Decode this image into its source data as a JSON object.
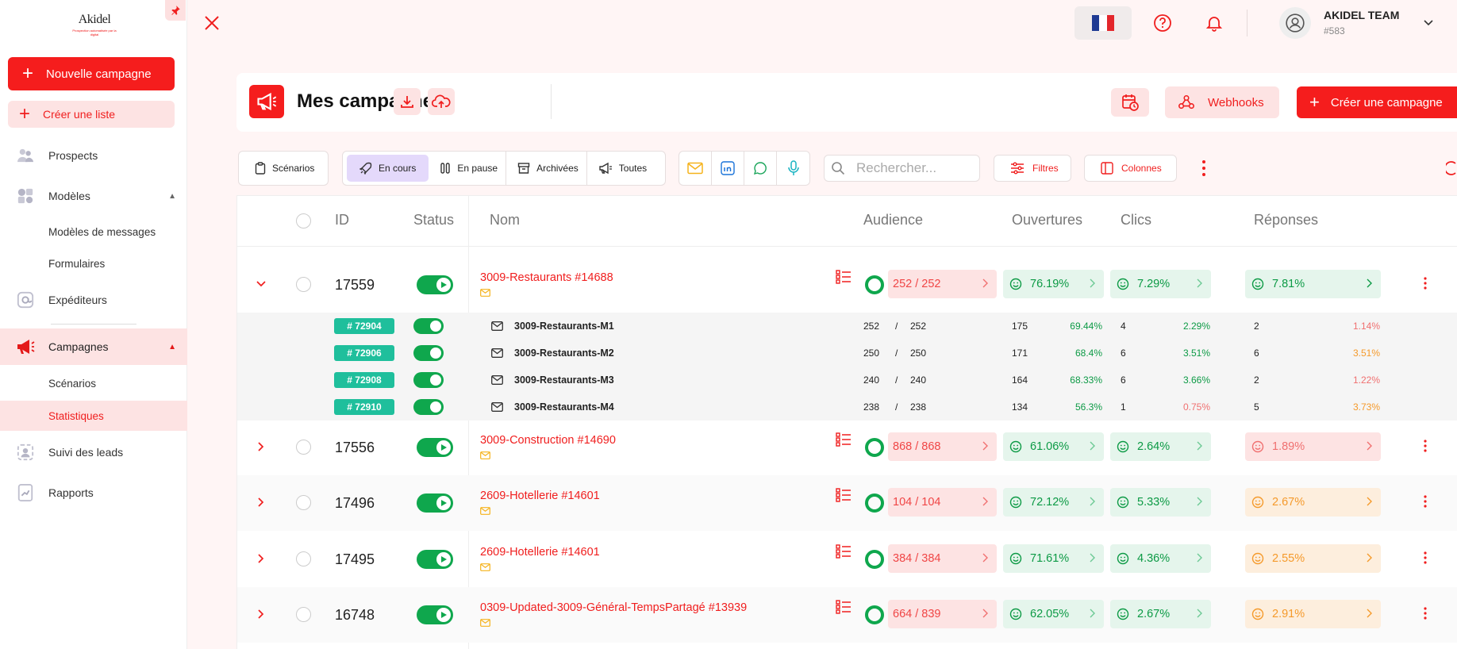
{
  "sidebar": {
    "logo_text": "Akidel",
    "logo_tag": "Prospection automatisée par la digital",
    "new_campaign": "Nouvelle campagne",
    "create_list": "Créer une liste",
    "items": {
      "prospects": "Prospects",
      "modeles": "Modèles",
      "modeles_messages": "Modèles de messages",
      "formulaires": "Formulaires",
      "expediteurs": "Expéditeurs",
      "campagnes": "Campagnes",
      "scenarios": "Scénarios",
      "statistiques": "Statistiques",
      "suivi": "Suivi des leads",
      "rapports": "Rapports"
    }
  },
  "topbar": {
    "user_name": "AKIDEL TEAM",
    "user_id": "#583"
  },
  "header": {
    "title": "Mes campagnes",
    "webhooks": "Webhooks",
    "create": "Créer une campagne"
  },
  "toolbar": {
    "scenarios": "Scénarios",
    "en_cours": "En cours",
    "en_pause": "En pause",
    "archivees": "Archivées",
    "toutes": "Toutes",
    "search_placeholder": "Rechercher...",
    "filtres": "Filtres",
    "colonnes": "Colonnes"
  },
  "table": {
    "headers": {
      "id": "ID",
      "status": "Status",
      "nom": "Nom",
      "audience": "Audience",
      "ouvertures": "Ouvertures",
      "clics": "Clics",
      "reponses": "Réponses"
    },
    "rows": [
      {
        "id": "17559",
        "name": "3009-Restaurants #14688",
        "audience": "252 / 252",
        "ouvertures": "76.19%",
        "clics": "7.29%",
        "reponses": "7.81%",
        "rep_tone": "g",
        "expanded": true
      },
      {
        "id": "17556",
        "name": "3009-Construction #14690",
        "audience": "868 / 868",
        "ouvertures": "61.06%",
        "clics": "2.64%",
        "reponses": "1.89%",
        "rep_tone": "r",
        "expanded": false
      },
      {
        "id": "17496",
        "name": "2609-Hotellerie #14601",
        "audience": "104 / 104",
        "ouvertures": "72.12%",
        "clics": "5.33%",
        "reponses": "2.67%",
        "rep_tone": "o",
        "expanded": false
      },
      {
        "id": "17495",
        "name": "2609-Hotellerie #14601",
        "audience": "384 / 384",
        "ouvertures": "71.61%",
        "clics": "4.36%",
        "reponses": "2.55%",
        "rep_tone": "o",
        "expanded": false
      },
      {
        "id": "16748",
        "name": "0309-Updated-3009-Général-TempsPartagé #13939",
        "audience": "664 / 839",
        "ouvertures": "62.05%",
        "clics": "2.67%",
        "reponses": "2.91%",
        "rep_tone": "o",
        "expanded": false
      }
    ],
    "subrows": [
      {
        "badge": "# 72904",
        "name": "3009-Restaurants-M1",
        "aud_a": "252",
        "aud_b": "252",
        "open_n": "175",
        "open_p": "69.44%",
        "click_n": "4",
        "click_p": "2.29%",
        "click_tone": "g",
        "rep_n": "2",
        "rep_p": "1.14%",
        "rep_tone": "r"
      },
      {
        "badge": "# 72906",
        "name": "3009-Restaurants-M2",
        "aud_a": "250",
        "aud_b": "250",
        "open_n": "171",
        "open_p": "68.4%",
        "click_n": "6",
        "click_p": "3.51%",
        "click_tone": "g",
        "rep_n": "6",
        "rep_p": "3.51%",
        "rep_tone": "o"
      },
      {
        "badge": "# 72908",
        "name": "3009-Restaurants-M3",
        "aud_a": "240",
        "aud_b": "240",
        "open_n": "164",
        "open_p": "68.33%",
        "click_n": "6",
        "click_p": "3.66%",
        "click_tone": "g",
        "rep_n": "2",
        "rep_p": "1.22%",
        "rep_tone": "r"
      },
      {
        "badge": "# 72910",
        "name": "3009-Restaurants-M4",
        "aud_a": "238",
        "aud_b": "238",
        "open_n": "134",
        "open_p": "56.3%",
        "click_n": "1",
        "click_p": "0.75%",
        "click_tone": "r",
        "rep_n": "5",
        "rep_p": "3.73%",
        "rep_tone": "o"
      }
    ]
  },
  "colors": {
    "brand_red": "#f51d1d",
    "green": "#0fa74d",
    "teal_badge": "#1fbf9c",
    "orange": "#f59a2b"
  }
}
